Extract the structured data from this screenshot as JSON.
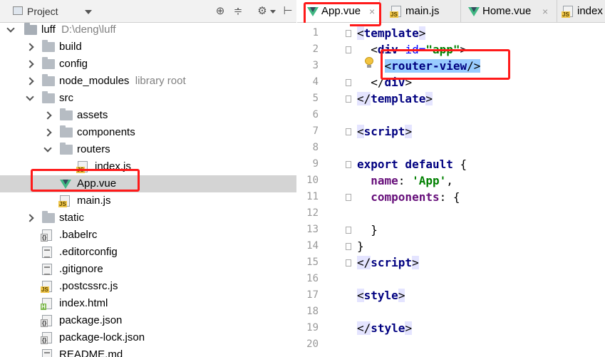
{
  "project_panel": {
    "title": "Project",
    "tools": [
      "⊕",
      "≑",
      "⚙",
      "⊢"
    ],
    "tree": [
      {
        "label": "luff",
        "note": "D:\\deng\\luff",
        "type": "folder",
        "depth": 0,
        "expanded": true
      },
      {
        "label": "build",
        "type": "folder",
        "depth": 1,
        "expanded": false
      },
      {
        "label": "config",
        "type": "folder",
        "depth": 1,
        "expanded": false
      },
      {
        "label": "node_modules",
        "note": "library root",
        "type": "folder",
        "depth": 1,
        "expanded": false
      },
      {
        "label": "src",
        "type": "folder",
        "depth": 1,
        "expanded": true
      },
      {
        "label": "assets",
        "type": "folder",
        "depth": 2,
        "expanded": false
      },
      {
        "label": "components",
        "type": "folder",
        "depth": 2,
        "expanded": false
      },
      {
        "label": "routers",
        "type": "folder",
        "depth": 2,
        "expanded": true
      },
      {
        "label": "index.js",
        "type": "js",
        "depth": 3
      },
      {
        "label": "App.vue",
        "type": "vue",
        "depth": 2,
        "selected": true
      },
      {
        "label": "main.js",
        "type": "js",
        "depth": 2
      },
      {
        "label": "static",
        "type": "folder",
        "depth": 1,
        "expanded": false
      },
      {
        "label": ".babelrc",
        "type": "json",
        "depth": 1
      },
      {
        "label": ".editorconfig",
        "type": "text",
        "depth": 1
      },
      {
        "label": ".gitignore",
        "type": "text",
        "depth": 1
      },
      {
        "label": ".postcssrc.js",
        "type": "js",
        "depth": 1
      },
      {
        "label": "index.html",
        "type": "html",
        "depth": 1
      },
      {
        "label": "package.json",
        "type": "json",
        "depth": 1
      },
      {
        "label": "package-lock.json",
        "type": "json",
        "depth": 1
      },
      {
        "label": "README.md",
        "type": "text",
        "depth": 1
      }
    ]
  },
  "editor": {
    "tabs": [
      {
        "label": "App.vue",
        "icon": "vue-icon",
        "active": true,
        "close": "×"
      },
      {
        "label": "main.js",
        "icon": "js-file-icon",
        "active": false,
        "close": ""
      },
      {
        "label": "Home.vue",
        "icon": "vue-icon",
        "active": false,
        "close": "×"
      },
      {
        "label": "index",
        "icon": "js-file-icon",
        "active": false,
        "close": ""
      }
    ],
    "line_numbers": [
      "1",
      "2",
      "3",
      "4",
      "5",
      "6",
      "7",
      "8",
      "9",
      "10",
      "11",
      "12",
      "13",
      "14",
      "15",
      "16",
      "17",
      "18",
      "19",
      "20"
    ],
    "code": {
      "l1": [
        "<",
        "template",
        ">"
      ],
      "l2": [
        "  <",
        "div",
        " ",
        "id",
        "=",
        "\"app\"",
        ">"
      ],
      "l3": [
        "    <",
        "router-view",
        "/>"
      ],
      "l4": [
        "  </",
        "div",
        ">"
      ],
      "l5": [
        "</",
        "template",
        ">"
      ],
      "l7": [
        "<",
        "script",
        ">"
      ],
      "l9": [
        "export default",
        " {"
      ],
      "l10": [
        "  ",
        "name",
        ": ",
        "'App'",
        ","
      ],
      "l11": [
        "  ",
        "components",
        ": {"
      ],
      "l13": [
        "  }"
      ],
      "l14": [
        "}"
      ],
      "l15": [
        "</",
        "script",
        ">"
      ],
      "l17": [
        "<",
        "style",
        ">"
      ],
      "l19": [
        "</",
        "style",
        ">"
      ]
    }
  },
  "colors": {
    "annotation_red": "#ff1a1a",
    "vue_green": "#41b883",
    "selection_gray": "#d4d4d4"
  }
}
